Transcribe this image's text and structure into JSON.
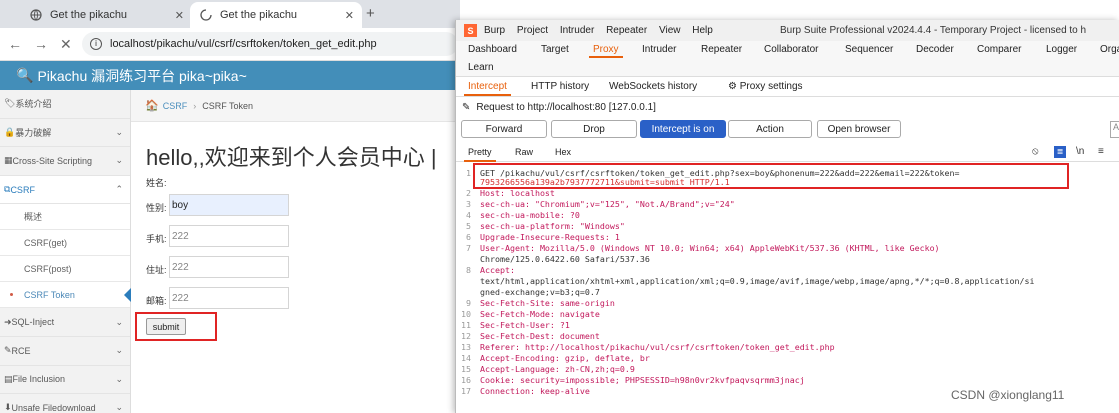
{
  "browser": {
    "tabs": [
      {
        "title": "Get the pikachu"
      },
      {
        "title": "Get the pikachu"
      }
    ],
    "url": "localhost/pikachu/vul/csrf/csrftoken/token_get_edit.php"
  },
  "pikachu": {
    "header_title": "Pikachu 漏洞练习平台 pika~pika~",
    "sidebar": [
      {
        "label": "系统介绍"
      },
      {
        "label": "暴力破解"
      },
      {
        "label": "Cross-Site Scripting"
      },
      {
        "label": "CSRF"
      },
      {
        "label": "概述"
      },
      {
        "label": "CSRF(get)"
      },
      {
        "label": "CSRF(post)"
      },
      {
        "label": "CSRF Token"
      },
      {
        "label": "SQL-Inject"
      },
      {
        "label": "RCE"
      },
      {
        "label": "File Inclusion"
      },
      {
        "label": "Unsafe Filedownload"
      }
    ],
    "breadcrumb": {
      "parent": "CSRF",
      "current": "CSRF Token"
    },
    "welcome": "hello,,欢迎来到个人会员中心 |",
    "form": {
      "name_label": "姓名:",
      "sex_label": "性别:",
      "sex_value": "boy",
      "phone_label": "手机:",
      "phone_value": "222",
      "address_label": "住址:",
      "address_value": "222",
      "email_label": "邮箱:",
      "email_value": "222",
      "submit_label": "submit"
    }
  },
  "burp": {
    "menu": [
      "Burp",
      "Project",
      "Intruder",
      "Repeater",
      "View",
      "Help"
    ],
    "window_title": "Burp Suite Professional v2024.4.4 - Temporary Project - licensed to h",
    "tabs_row1": [
      "Dashboard",
      "Target",
      "Proxy",
      "Intruder",
      "Repeater",
      "Collaborator",
      "Sequencer",
      "Decoder",
      "Comparer",
      "Logger",
      "Orga"
    ],
    "tabs_row1b": "Learn",
    "active_tab": "Proxy",
    "proxy_tabs": [
      "Intercept",
      "HTTP history",
      "WebSockets history",
      "Proxy settings"
    ],
    "request_to": "Request to http://localhost:80  [127.0.0.1]",
    "buttons": {
      "forward": "Forward",
      "drop": "Drop",
      "intercept": "Intercept is on",
      "action": "Action",
      "open_browser": "Open browser"
    },
    "view_tabs": [
      "Pretty",
      "Raw",
      "Hex"
    ],
    "view_icons": {
      "hide": "⦸",
      "wrap": "≣",
      "newline": "\\n",
      "menu": "≡"
    },
    "request_lines": [
      "GET /pikachu/vul/csrf/csrftoken/token_get_edit.php?sex=boy&phonenum=222&add=222&email=222&token=",
      "7953266556a139a2b7937772711&submit=submit HTTP/1.1",
      "Host: localhost",
      "sec-ch-ua: \"Chromium\";v=\"125\", \"Not.A/Brand\";v=\"24\"",
      "sec-ch-ua-mobile: ?0",
      "sec-ch-ua-platform: \"Windows\"",
      "Upgrade-Insecure-Requests: 1",
      "User-Agent: Mozilla/5.0 (Windows NT 10.0; Win64; x64) AppleWebKit/537.36 (KHTML, like Gecko)",
      "Chrome/125.0.6422.60 Safari/537.36",
      "Accept:",
      "text/html,application/xhtml+xml,application/xml;q=0.9,image/avif,image/webp,image/apng,*/*;q=0.8,application/si",
      "gned-exchange;v=b3;q=0.7",
      "Sec-Fetch-Site: same-origin",
      "Sec-Fetch-Mode: navigate",
      "Sec-Fetch-User: ?1",
      "Sec-Fetch-Dest: document",
      "Referer: http://localhost/pikachu/vul/csrf/csrftoken/token_get_edit.php",
      "Accept-Encoding: gzip, deflate, br",
      "Accept-Language: zh-CN,zh;q=0.9",
      "Cookie: security=impossible; PHPSESSID=h98n0vr2kvfpaqvsqrmm3jnacj",
      "Connection: keep-alive"
    ]
  },
  "watermark": "CSDN @xionglang11"
}
